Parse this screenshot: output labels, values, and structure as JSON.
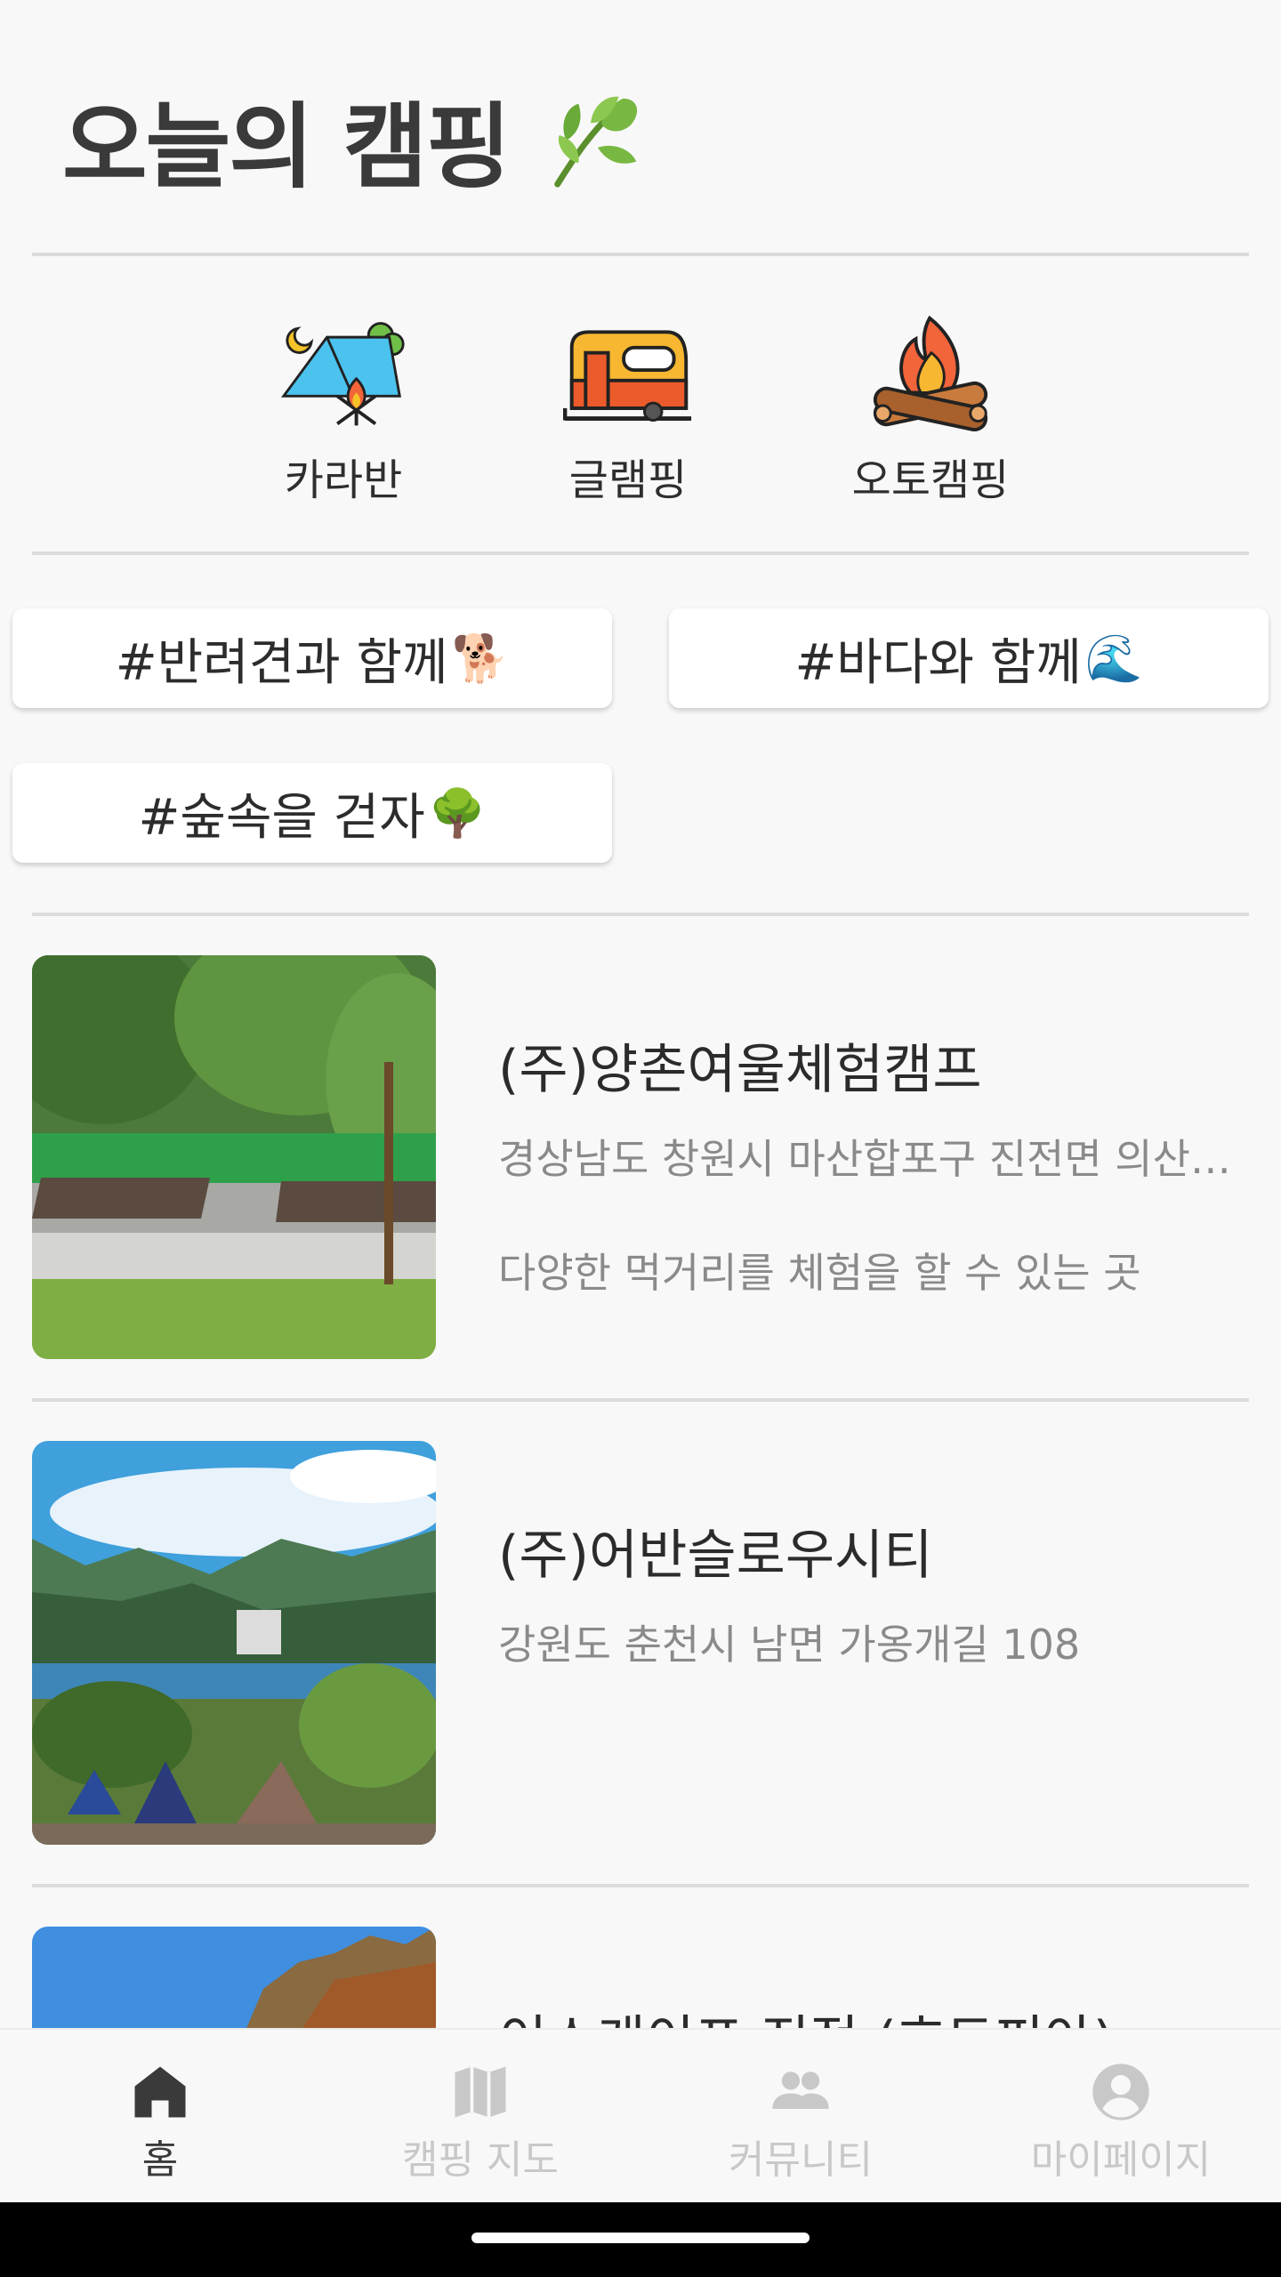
{
  "header": {
    "title": "오늘의 캠핑",
    "icon": "leaf-icon"
  },
  "categories": [
    {
      "label": "카라반",
      "icon": "tent-campfire-icon"
    },
    {
      "label": "글램핑",
      "icon": "camper-trailer-icon"
    },
    {
      "label": "오토캠핑",
      "icon": "campfire-icon"
    }
  ],
  "hashtags": [
    {
      "label": "#반려견과 함께",
      "emoji": "🐕"
    },
    {
      "label": "#바다와 함께",
      "emoji": "🌊"
    },
    {
      "label": "#숲속을 걷자",
      "emoji": "🌳"
    }
  ],
  "camps": [
    {
      "name": "(주)양촌여울체험캠프",
      "address": "경상남도 창원시 마산합포구 진전면 의산…",
      "description": "다양한 먹거리를 체험을 할 수 있는 곳"
    },
    {
      "name": "(주)어반슬로우시티",
      "address": "강원도 춘천시 남면 가옹개길 108",
      "description": ""
    },
    {
      "name": "이스케이프 진적 (호도피아)",
      "address": "",
      "description": ""
    }
  ],
  "bottom_nav": [
    {
      "label": "홈",
      "icon": "home-icon",
      "active": true
    },
    {
      "label": "캠핑 지도",
      "icon": "map-icon",
      "active": false
    },
    {
      "label": "커뮤니티",
      "icon": "people-icon",
      "active": false
    },
    {
      "label": "마이페이지",
      "icon": "account-circle-icon",
      "active": false
    }
  ],
  "colors": {
    "background": "#f8f8f9",
    "nav_active": "#3a3a3a",
    "nav_inactive": "#c8c8c8",
    "secondary_text": "#8a8a8a"
  }
}
